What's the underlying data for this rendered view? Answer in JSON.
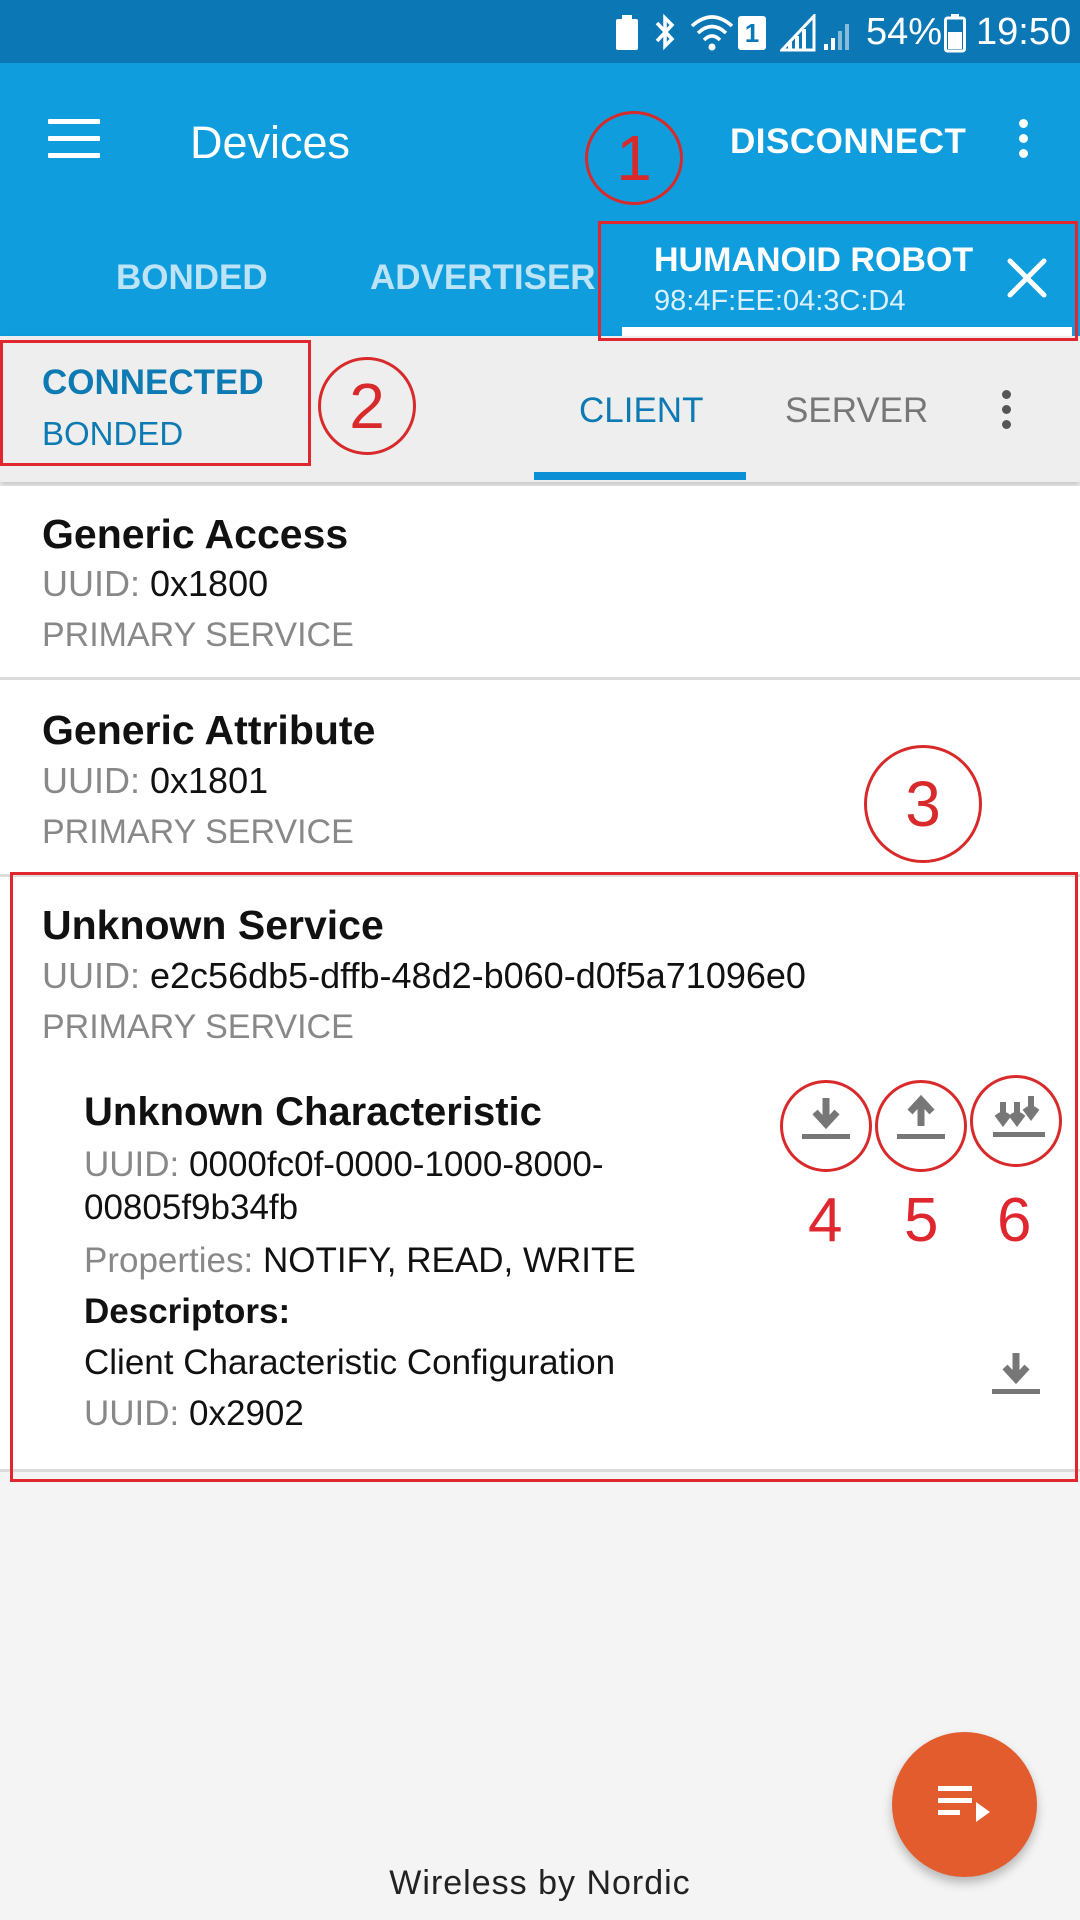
{
  "status_bar": {
    "battery": "54%",
    "time": "19:50",
    "sim": "1"
  },
  "app_bar": {
    "title": "Devices",
    "disconnect_label": "DISCONNECT",
    "tabs": [
      {
        "label": "BONDED"
      },
      {
        "label": "ADVERTISER"
      }
    ],
    "device_tab": {
      "name": "HUMANOID ROBOT",
      "address": "98:4F:EE:04:3C:D4"
    }
  },
  "connection": {
    "state": "CONNECTED",
    "bond": "BONDED"
  },
  "sub_tabs": [
    {
      "label": "CLIENT",
      "active": true
    },
    {
      "label": "SERVER",
      "active": false
    }
  ],
  "services": [
    {
      "name": "Generic Access",
      "uuid_label": "UUID:",
      "uuid": "0x1800",
      "type": "PRIMARY SERVICE"
    },
    {
      "name": "Generic Attribute",
      "uuid_label": "UUID:",
      "uuid": "0x1801",
      "type": "PRIMARY SERVICE"
    },
    {
      "name": "Unknown Service",
      "uuid_label": "UUID:",
      "uuid": "e2c56db5-dffb-48d2-b060-d0f5a71096e0",
      "type": "PRIMARY SERVICE"
    }
  ],
  "characteristic": {
    "name": "Unknown Characteristic",
    "uuid_label": "UUID:",
    "uuid_line1": "0000fc0f-0000-1000-8000-",
    "uuid_line2": "00805f9b34fb",
    "properties_label": "Properties:",
    "properties": "NOTIFY, READ, WRITE",
    "descriptors_label": "Descriptors:",
    "descriptor_name": "Client Characteristic Configuration",
    "descriptor_uuid_label": "UUID:",
    "descriptor_uuid": "0x2902",
    "action_icons": [
      "download-icon",
      "upload-icon",
      "notify-multiple-icon"
    ]
  },
  "annotations": [
    "1",
    "2",
    "3",
    "4",
    "5",
    "6"
  ],
  "footer": "Wireless by Nordic",
  "colors": {
    "status_bar": "#0c77b5",
    "app_bar": "#0f9ddd",
    "accent": "#0d7ab3",
    "fab": "#e25c2e",
    "annotation": "#e0262e"
  }
}
